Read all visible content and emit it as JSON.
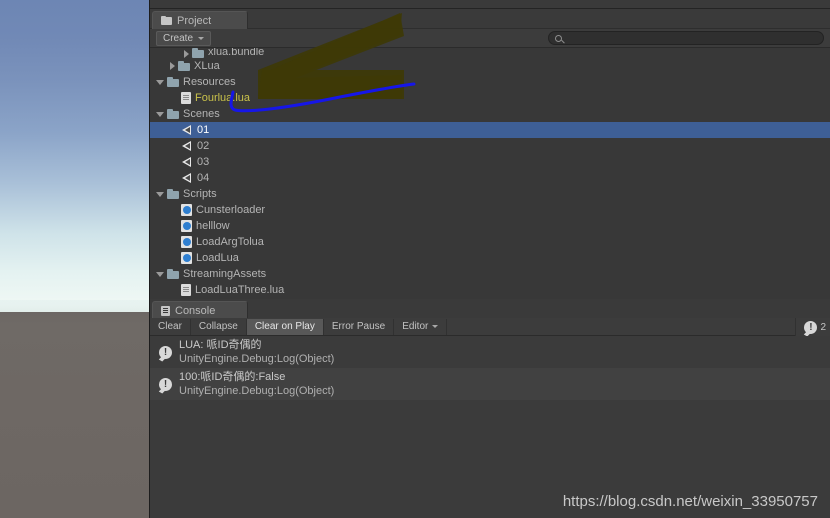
{
  "project_panel": {
    "tab_label": "Project",
    "tab_icon": "folder-icon",
    "toolbar": {
      "create_label": "Create",
      "search_value": "",
      "search_placeholder": ""
    },
    "tree": [
      {
        "indent": 2,
        "twisty": "closed",
        "icon": "folder-icon",
        "label": "xlua.bundle",
        "clipped": true,
        "selected": false
      },
      {
        "indent": 1,
        "twisty": "closed",
        "icon": "folder-icon",
        "label": "XLua",
        "clipped": false,
        "selected": false
      },
      {
        "indent": 0,
        "twisty": "open",
        "icon": "folder-icon",
        "label": "Resources",
        "clipped": false,
        "selected": false
      },
      {
        "indent": 1,
        "twisty": "none",
        "icon": "file-icon",
        "label": "Fourlua.lua",
        "clipped": false,
        "selected": false,
        "highlight": true
      },
      {
        "indent": 0,
        "twisty": "open",
        "icon": "folder-icon",
        "label": "Scenes",
        "clipped": false,
        "selected": false
      },
      {
        "indent": 1,
        "twisty": "none",
        "icon": "scene-icon",
        "label": "01",
        "clipped": false,
        "selected": true
      },
      {
        "indent": 1,
        "twisty": "none",
        "icon": "scene-icon",
        "label": "02",
        "clipped": false,
        "selected": false
      },
      {
        "indent": 1,
        "twisty": "none",
        "icon": "scene-icon",
        "label": "03",
        "clipped": false,
        "selected": false
      },
      {
        "indent": 1,
        "twisty": "none",
        "icon": "scene-icon",
        "label": "04",
        "clipped": false,
        "selected": false
      },
      {
        "indent": 0,
        "twisty": "open",
        "icon": "folder-icon",
        "label": "Scripts",
        "clipped": false,
        "selected": false
      },
      {
        "indent": 1,
        "twisty": "none",
        "icon": "csharp-icon",
        "label": "Cunsterloader",
        "clipped": false,
        "selected": false
      },
      {
        "indent": 1,
        "twisty": "none",
        "icon": "csharp-icon",
        "label": "helllow",
        "clipped": false,
        "selected": false
      },
      {
        "indent": 1,
        "twisty": "none",
        "icon": "csharp-icon",
        "label": "LoadArgTolua",
        "clipped": false,
        "selected": false
      },
      {
        "indent": 1,
        "twisty": "none",
        "icon": "csharp-icon",
        "label": "LoadLua",
        "clipped": false,
        "selected": false
      },
      {
        "indent": 0,
        "twisty": "open",
        "icon": "folder-icon",
        "label": "StreamingAssets",
        "clipped": false,
        "selected": false
      },
      {
        "indent": 1,
        "twisty": "none",
        "icon": "file-icon",
        "label": "LoadLuaThree.lua",
        "clipped": false,
        "selected": false
      }
    ]
  },
  "console_panel": {
    "tab_label": "Console",
    "tab_icon": "console-icon",
    "toolbar": {
      "clear_label": "Clear",
      "collapse_label": "Collapse",
      "clear_on_play_label": "Clear on Play",
      "error_pause_label": "Error Pause",
      "editor_label": "Editor",
      "info_count": "2"
    },
    "logs": [
      {
        "icon": "info-log-icon",
        "message": "LUA: 哌ID奇偶的",
        "stack": "UnityEngine.Debug:Log(Object)"
      },
      {
        "icon": "info-log-icon",
        "message": "100:哌ID奇偶的:False",
        "stack": "UnityEngine.Debug:Log(Object)"
      }
    ]
  },
  "watermark": {
    "text": "https://blog.csdn.net/weixin_33950757"
  },
  "colors": {
    "selection_blue": "#3e5f96",
    "panel_bg": "#383838",
    "toolbar_bg": "#3c3c3c",
    "annotation_olive": "#3d3a06",
    "annotation_blue": "#1414e6",
    "highlight_yellow": "#c9c14a"
  },
  "annotations": [
    {
      "name": "olive-arrow-annotation",
      "color": "#3d3a06"
    },
    {
      "name": "blue-underline-annotation",
      "color": "#1414e6"
    }
  ],
  "game_view": {
    "sky_top": "#6d86b4",
    "sky_horizon": "#eef7f4",
    "ground": "#6c6663"
  }
}
